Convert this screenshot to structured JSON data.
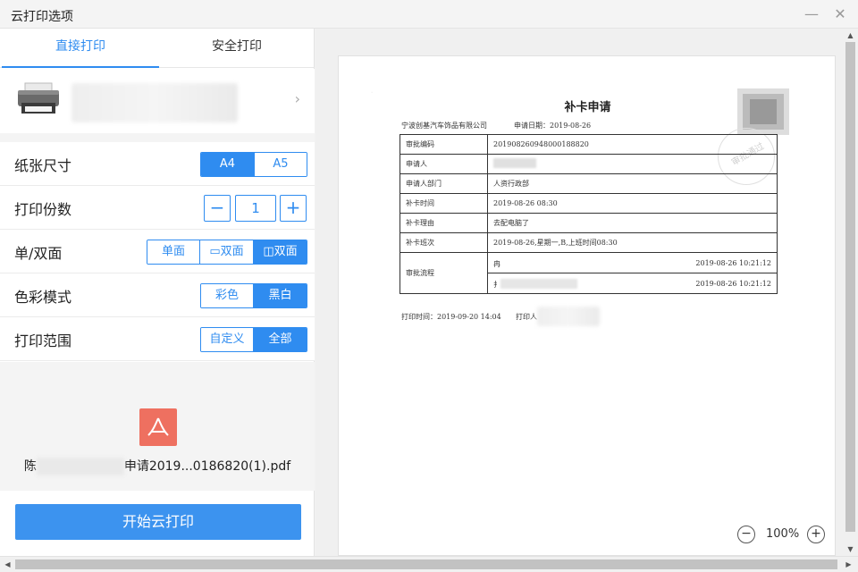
{
  "window": {
    "title": "云打印选项",
    "minimize_glyph": "—",
    "close_glyph": "✕"
  },
  "tabs": [
    {
      "label": "直接打印",
      "active": true
    },
    {
      "label": "安全打印",
      "active": false
    }
  ],
  "printer": {
    "icon": "printer-icon",
    "arrow": "›"
  },
  "options": {
    "paper_size": {
      "label": "纸张尺寸",
      "choices": [
        "A4",
        "A5"
      ],
      "selected": "A4"
    },
    "copies": {
      "label": "打印份数",
      "minus": "−",
      "value": "1",
      "plus": "+"
    },
    "duplex": {
      "label": "单/双面",
      "choices": [
        "单面",
        "双面",
        "双面"
      ],
      "selected_index": 2
    },
    "color_mode": {
      "label": "色彩模式",
      "choices": [
        "彩色",
        "黑白"
      ],
      "selected": "黑白"
    },
    "range": {
      "label": "打印范围",
      "choices": [
        "自定义",
        "全部"
      ],
      "selected": "全部"
    }
  },
  "file": {
    "prefix": "陈",
    "suffix": "申请2019...0186820(1).pdf",
    "icon": "pdf-icon"
  },
  "start_button": "开始云打印",
  "preview": {
    "doc_title": "补卡申请",
    "company": "宁波创基汽车饰品有限公司",
    "apply_date": "申请日期：2019-08-26",
    "stamp_text": "审批通过",
    "rows": [
      {
        "k": "审批编码",
        "v": "201908260948000188820"
      },
      {
        "k": "申请人",
        "v": ""
      },
      {
        "k": "申请人部门",
        "v": "人资行政部"
      },
      {
        "k": "补卡时间",
        "v": "2019-08-26  08:30"
      },
      {
        "k": "补卡理由",
        "v": "去配电脑了"
      },
      {
        "k": "补卡班次",
        "v": "2019-08-26,星期一,B,上班时间08:30"
      }
    ],
    "flow_label": "审批流程",
    "flow": [
      {
        "who": "冉",
        "time": "2019-08-26  10:21:12"
      },
      {
        "who": "扌",
        "time": "2019-08-26  10:21:12"
      }
    ],
    "print_time": "打印时间：2019-09-20 14:04",
    "printer_person": "打印人",
    "zoom": {
      "minus": "−",
      "value": "100%",
      "plus": "+"
    }
  },
  "scrollbars": {
    "up": "▲",
    "down": "▼",
    "left": "◀",
    "right": "▶"
  }
}
